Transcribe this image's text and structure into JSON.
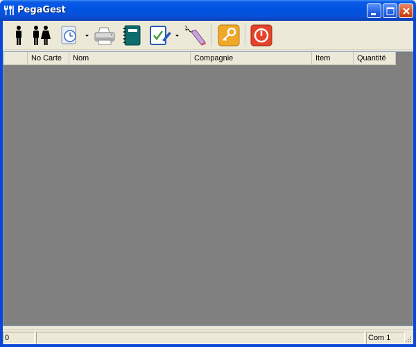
{
  "window": {
    "title": "PegaGest",
    "icon": "cutlery-icon"
  },
  "titlebar_buttons": {
    "minimize": "minimize-icon",
    "maximize": "maximize-icon",
    "close": "close-icon"
  },
  "toolbar": {
    "items": [
      {
        "name": "single-person-icon"
      },
      {
        "name": "couple-icon"
      },
      {
        "name": "clock-document-icon",
        "dropdown": true
      },
      {
        "name": "printer-icon"
      },
      {
        "name": "notebook-icon"
      },
      {
        "name": "checklist-pen-icon",
        "dropdown": true
      },
      {
        "name": "eraser-icon"
      },
      {
        "name": "key-icon"
      },
      {
        "name": "power-icon"
      }
    ]
  },
  "grid": {
    "columns": [
      "",
      "No Carte",
      "Nom",
      "Compagnie",
      "Item",
      "Quantité"
    ],
    "rows": []
  },
  "status": {
    "left": "0",
    "middle": "",
    "right": "Com 1"
  },
  "colors": {
    "title_bar": "#0054e3",
    "grid_background": "#808080",
    "chrome": "#ece9d8",
    "close_button": "#d9541f"
  }
}
